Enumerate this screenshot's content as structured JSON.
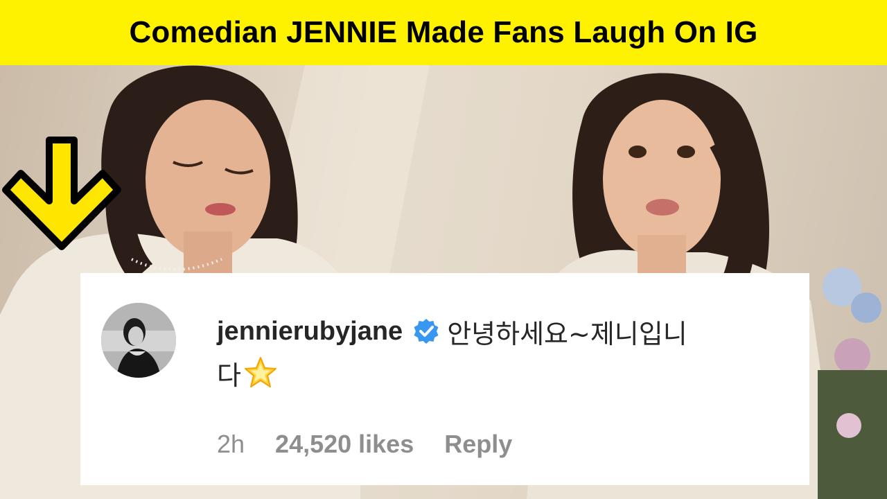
{
  "banner": {
    "title": "Comedian JENNIE Made Fans Laugh On IG"
  },
  "comment": {
    "username": "jennierubyjane",
    "verified": true,
    "text_line1": "안녕하세요~제니입니",
    "text_line2": "다",
    "emoji": "glowing-star",
    "time": "2h",
    "likes": "24,520 likes",
    "reply_label": "Reply"
  },
  "colors": {
    "banner_bg": "#fff200",
    "arrow_fill": "#ffe600",
    "verified_blue": "#3897f0",
    "meta_gray": "#8e8e8e",
    "text_dark": "#262626"
  }
}
